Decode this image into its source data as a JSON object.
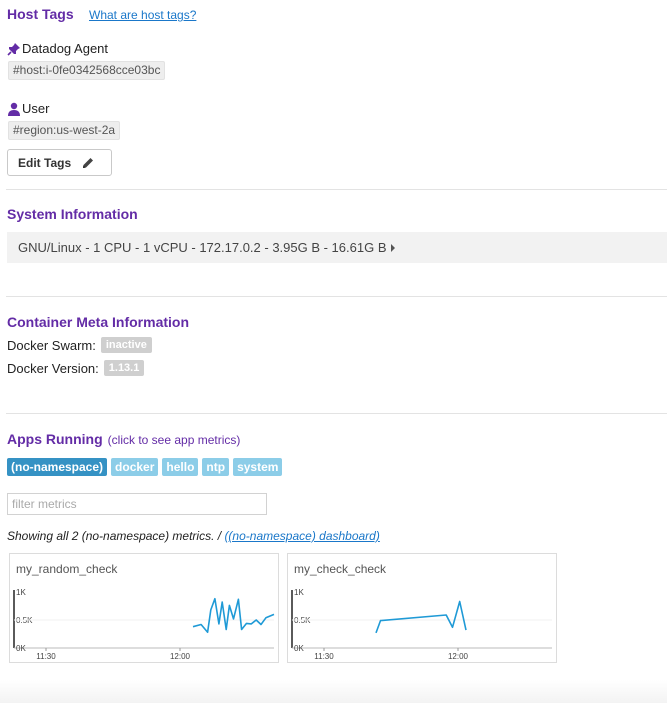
{
  "host_tags": {
    "title": "Host Tags",
    "help_link": "What are host tags?",
    "groups": [
      {
        "source": "Datadog Agent",
        "icon": "pushpin-icon",
        "tags": [
          "#host:i-0fe0342568cce03bc"
        ]
      },
      {
        "source": "User",
        "icon": "user-icon",
        "tags": [
          "#region:us-west-2a"
        ]
      }
    ],
    "edit_button": "Edit Tags"
  },
  "system_info": {
    "title": "System Information",
    "summary": "GNU/Linux - 1 CPU - 1 vCPU - 172.17.0.2 - 3.95G B - 16.61G B"
  },
  "container_meta": {
    "title": "Container Meta Information",
    "rows": [
      {
        "label": "Docker Swarm:",
        "value": "inactive"
      },
      {
        "label": "Docker Version:",
        "value": "1.13.1"
      }
    ]
  },
  "apps": {
    "title": "Apps Running",
    "subtitle": "(click to see app metrics)",
    "chips": [
      "(no-namespace)",
      "docker",
      "hello",
      "ntp",
      "system"
    ],
    "active_chip": "(no-namespace)",
    "filter_placeholder": "filter metrics",
    "showing_text": "Showing all 2 (no-namespace) metrics. / ",
    "dashboard_link": "((no-namespace) dashboard)"
  },
  "colors": {
    "accent": "#632ca6",
    "link": "#1a77c9",
    "chip_active": "#3592c4",
    "chip": "#8ccde8",
    "series": "#1f9ad6"
  },
  "chart_data": [
    {
      "type": "line",
      "title": "my_random_check",
      "y_ticks": [
        "1K",
        "0.5K",
        "0K"
      ],
      "ylim": [
        0,
        1000
      ],
      "x_ticks": [
        "11:30",
        "12:00"
      ],
      "series": [
        {
          "points": [
            [
              0.0,
              380
            ],
            [
              0.1,
              420
            ],
            [
              0.18,
              280
            ],
            [
              0.22,
              680
            ],
            [
              0.27,
              880
            ],
            [
              0.32,
              430
            ],
            [
              0.36,
              820
            ],
            [
              0.41,
              330
            ],
            [
              0.45,
              760
            ],
            [
              0.5,
              520
            ],
            [
              0.56,
              870
            ],
            [
              0.6,
              330
            ],
            [
              0.66,
              440
            ],
            [
              0.72,
              430
            ],
            [
              0.78,
              500
            ],
            [
              0.84,
              420
            ],
            [
              0.9,
              540
            ],
            [
              1.0,
              600
            ]
          ]
        }
      ]
    },
    {
      "type": "line",
      "title": "my_check_check",
      "y_ticks": [
        "1K",
        "0.5K",
        "0K"
      ],
      "ylim": [
        0,
        1000
      ],
      "x_ticks": [
        "11:30",
        "12:00"
      ],
      "series": [
        {
          "points": [
            [
              0.0,
              270
            ],
            [
              0.05,
              490
            ],
            [
              0.78,
              590
            ],
            [
              0.85,
              370
            ],
            [
              0.93,
              830
            ],
            [
              1.0,
              320
            ]
          ]
        }
      ]
    }
  ]
}
